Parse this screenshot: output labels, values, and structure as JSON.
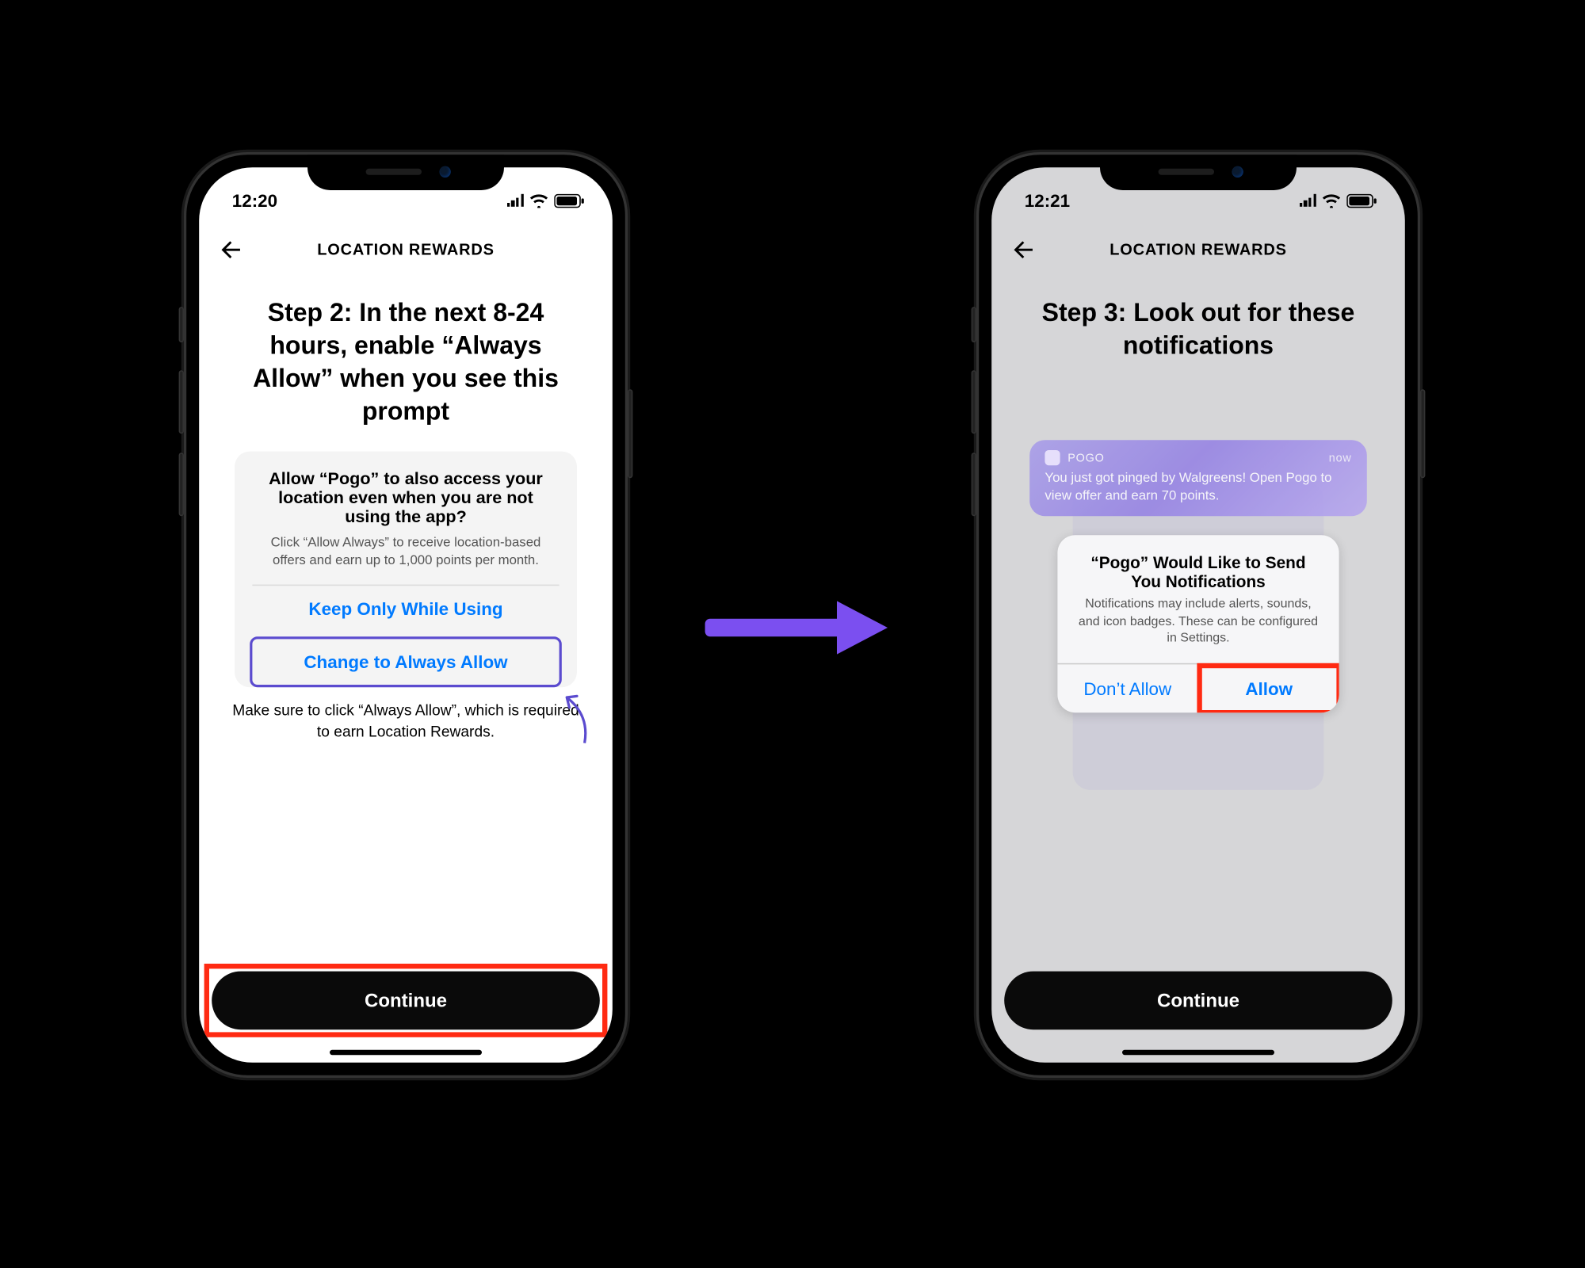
{
  "left": {
    "time": "12:20",
    "nav_title": "LOCATION REWARDS",
    "heading": "Step 2: In the next 8-24 hours, enable “Always Allow” when you see this prompt",
    "prompt_title": "Allow “Pogo” to also access your location even when you are not using the app?",
    "prompt_desc": "Click “Allow Always” to receive location-based offers and earn up to 1,000 points per month.",
    "opt_keep": "Keep Only While Using",
    "opt_change": "Change to Always Allow",
    "hint": "Make sure to click “Always Allow”, which is required to earn Location Rewards.",
    "continue_label": "Continue"
  },
  "right": {
    "time": "12:21",
    "nav_title": "LOCATION REWARDS",
    "heading": "Step 3: Look out for these notifications",
    "banner_app": "POGO",
    "banner_when": "now",
    "banner_text": "You just got pinged by Walgreens! Open Pogo to view offer and earn 70 points.",
    "alert_title": "“Pogo” Would Like to Send You Notifications",
    "alert_desc": "Notifications may include alerts, sounds, and icon badges. These can be configured in Settings.",
    "alert_deny": "Don’t Allow",
    "alert_allow": "Allow",
    "continue_label": "Continue"
  }
}
